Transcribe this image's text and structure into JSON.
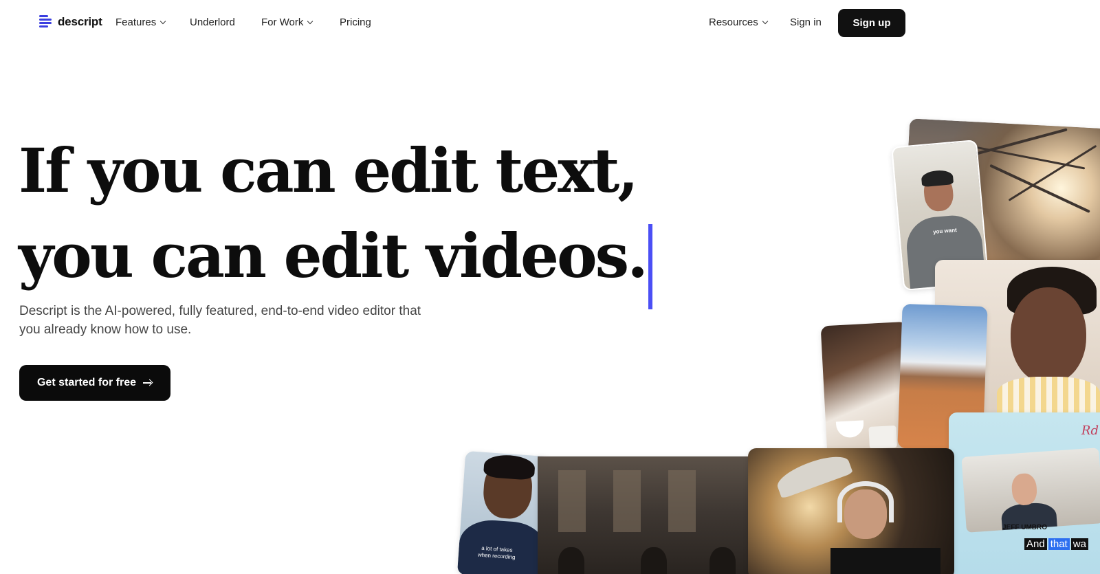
{
  "nav": {
    "logo_text": "descript",
    "items": [
      {
        "label": "Features",
        "dropdown": true
      },
      {
        "label": "Underlord",
        "dropdown": false
      },
      {
        "label": "For Work",
        "dropdown": true
      },
      {
        "label": "Pricing",
        "dropdown": false
      }
    ],
    "resources_label": "Resources",
    "sign_in_label": "Sign in",
    "sign_up_label": "Sign up"
  },
  "hero": {
    "headline_line1": "If you can edit text,",
    "headline_line2": "you can edit videos.",
    "subheadline": "Descript is the AI-powered, fully featured, end-to-end video editor that you already know how to use.",
    "cta_label": "Get started for free"
  },
  "collage": {
    "man_caption": "you want",
    "guy_caption_line1": "a lot of takes",
    "guy_caption_line2": "when recording",
    "poster_logo": "Rd",
    "poster_name": "JEFF UMBRO",
    "poster_caption_words": [
      "And",
      "that",
      "wa"
    ]
  },
  "colors": {
    "accent": "#4b4ff5",
    "brand": "#3b3fe0",
    "button_bg": "#111111",
    "caption_highlight": "#2d6ff0"
  }
}
